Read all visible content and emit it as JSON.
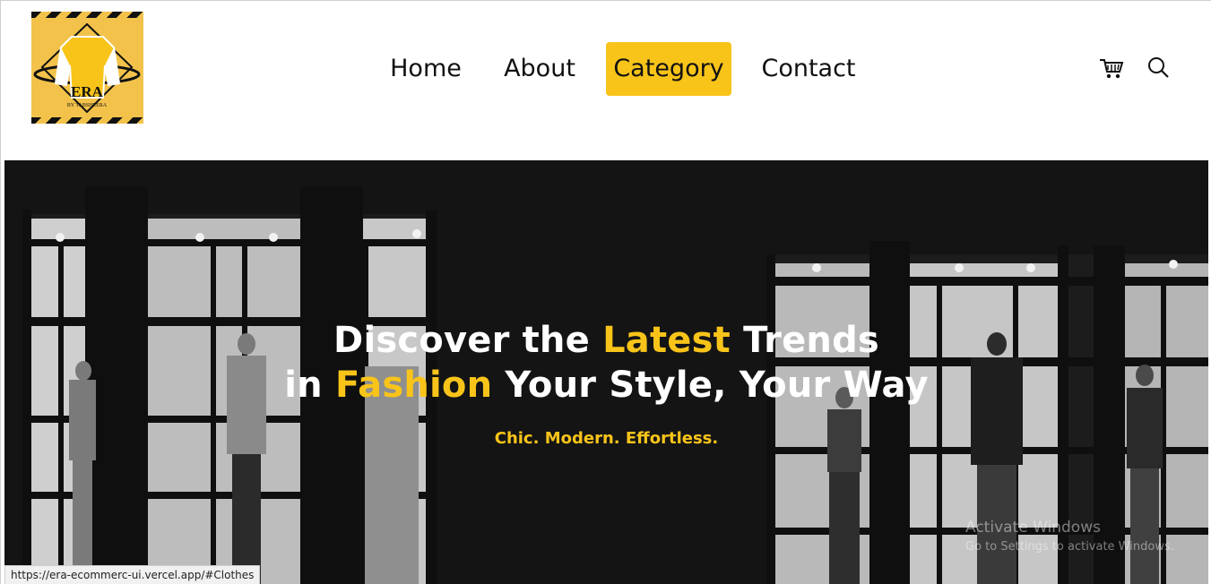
{
  "header": {
    "logo": {
      "brand": "ERA",
      "tagline": "BY TABSHEERA"
    },
    "nav": [
      {
        "label": "Home",
        "active": false
      },
      {
        "label": "About",
        "active": false
      },
      {
        "label": "Category",
        "active": true
      },
      {
        "label": "Contact",
        "active": false
      }
    ],
    "icons": [
      "cart-icon",
      "search-icon"
    ]
  },
  "hero": {
    "line1_part1": "Discover the ",
    "line1_highlight": "Latest",
    "line1_part2": " Trends",
    "line2_part1": "in ",
    "line2_highlight": "Fashion",
    "line2_part2": " Your Style, Your Way",
    "subtitle": "Chic. Modern. Effortless."
  },
  "watermark": {
    "title": "Activate Windows",
    "subtitle": "Go to Settings to activate Windows."
  },
  "status_bar": {
    "url": "https://era-ecommerc-ui.vercel.app/#Clothes"
  },
  "colors": {
    "accent": "#f8c41a",
    "hero_bg": "#121212",
    "text": "#111111"
  }
}
